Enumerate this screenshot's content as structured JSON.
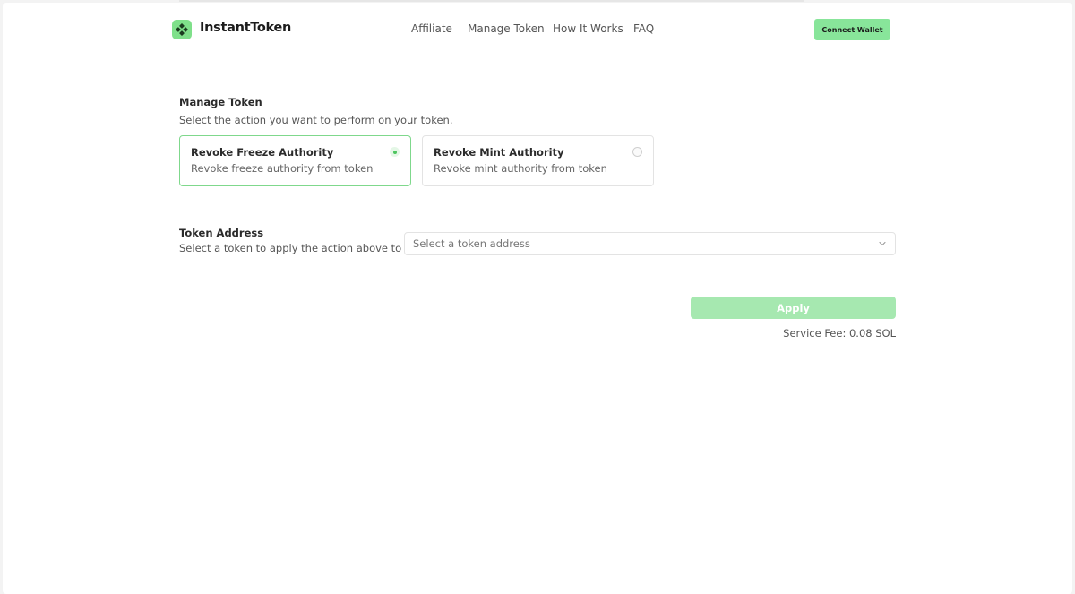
{
  "header": {
    "brand": "InstantToken",
    "logo_icon": "diamond-grid-icon",
    "nav": [
      {
        "label": "Affiliate"
      },
      {
        "label": "Manage Token"
      },
      {
        "label": "How It Works"
      },
      {
        "label": "FAQ"
      }
    ],
    "connect_label": "Connect Wallet"
  },
  "manage": {
    "title": "Manage Token",
    "subtitle": "Select the action you want to perform on your token.",
    "options": [
      {
        "title": "Revoke Freeze Authority",
        "description": "Revoke freeze authority from token",
        "selected": true
      },
      {
        "title": "Revoke Mint Authority",
        "description": "Revoke mint authority from token",
        "selected": false
      }
    ]
  },
  "address": {
    "title": "Token Address",
    "subtitle": "Select a token to apply the action above to it.",
    "placeholder": "Select a token address"
  },
  "apply": {
    "label": "Apply",
    "fee": "Service Fee: 0.08 SOL"
  },
  "colors": {
    "accent": "#88e59a",
    "apply_disabled": "#a6e8b0",
    "selected_border": "#7fd88c"
  }
}
